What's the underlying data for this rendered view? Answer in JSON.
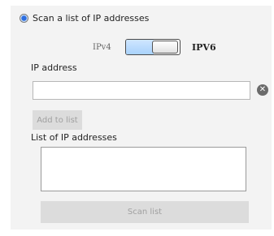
{
  "scan_option": {
    "label": "Scan a list of IP addresses",
    "selected": true
  },
  "ip_version": {
    "left_label": "IPv4",
    "right_label": "IPV6",
    "selected": "IPV6"
  },
  "ip_address": {
    "label": "IP address",
    "value": "",
    "placeholder": "",
    "clear_icon": "clear-circle-x-icon"
  },
  "add_button": {
    "label": "Add to list",
    "enabled": false
  },
  "ip_list": {
    "label": "List of IP addresses",
    "items": []
  },
  "scan_button": {
    "label": "Scan list",
    "enabled": false
  },
  "colors": {
    "panel_background": "#f3f3f3",
    "toggle_fill": "#a9d2fb",
    "disabled_button": "#dcdcdc",
    "disabled_text": "#a0a0a0"
  }
}
